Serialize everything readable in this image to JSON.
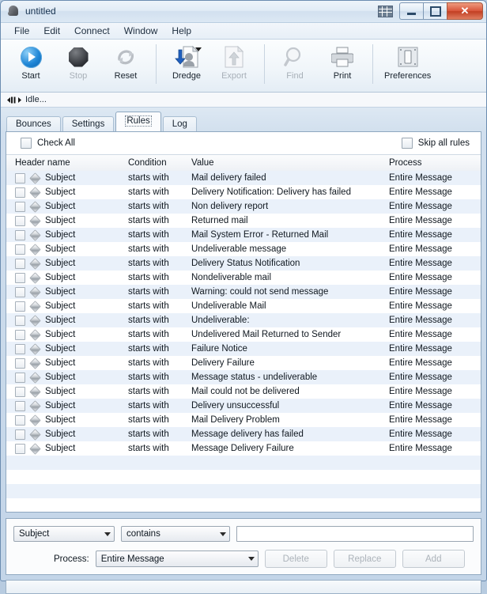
{
  "window": {
    "title": "untitled",
    "app_icon": "boot-icon",
    "controls": {
      "grid": "grid-icon",
      "minimize": "minimize-icon",
      "maximize": "maximize-icon",
      "close": "✕"
    }
  },
  "menu": [
    "File",
    "Edit",
    "Connect",
    "Window",
    "Help"
  ],
  "toolbar": [
    {
      "label": "Start",
      "icon": "play-icon",
      "disabled": false,
      "dropdown": false
    },
    {
      "label": "Stop",
      "icon": "stop-octagon-icon",
      "disabled": true,
      "dropdown": false
    },
    {
      "label": "Reset",
      "icon": "refresh-icon",
      "disabled": false,
      "dropdown": false
    },
    {
      "label": "Dredge",
      "icon": "dredge-download-icon",
      "disabled": false,
      "dropdown": true
    },
    {
      "label": "Export",
      "icon": "export-upload-icon",
      "disabled": true,
      "dropdown": false
    },
    {
      "label": "Find",
      "icon": "magnifier-icon",
      "disabled": true,
      "dropdown": false
    },
    {
      "label": "Print",
      "icon": "printer-icon",
      "disabled": false,
      "dropdown": false
    },
    {
      "label": "Preferences",
      "icon": "preferences-icon",
      "disabled": false,
      "dropdown": false
    }
  ],
  "status": {
    "icon": "connection-icon",
    "text": "Idle..."
  },
  "tabs": [
    {
      "label": "Bounces",
      "active": false
    },
    {
      "label": "Settings",
      "active": false
    },
    {
      "label": "Rules",
      "active": true
    },
    {
      "label": "Log",
      "active": false
    }
  ],
  "controls_bar": {
    "check_all_label": "Check All",
    "check_all_checked": false,
    "skip_all_label": "Skip all rules",
    "skip_all_checked": false
  },
  "table": {
    "columns": [
      "Header name",
      "Condition",
      "Value",
      "Process"
    ],
    "rows": [
      {
        "header": "Subject",
        "condition": "starts with",
        "value": "Mail delivery failed",
        "process": "Entire Message",
        "checked": false
      },
      {
        "header": "Subject",
        "condition": "starts with",
        "value": "Delivery Notification: Delivery has failed",
        "process": "Entire Message",
        "checked": false
      },
      {
        "header": "Subject",
        "condition": "starts with",
        "value": "Non delivery report",
        "process": "Entire Message",
        "checked": false
      },
      {
        "header": "Subject",
        "condition": "starts with",
        "value": "Returned mail",
        "process": "Entire Message",
        "checked": false
      },
      {
        "header": "Subject",
        "condition": "starts with",
        "value": "Mail System Error - Returned Mail",
        "process": "Entire Message",
        "checked": false
      },
      {
        "header": "Subject",
        "condition": "starts with",
        "value": "Undeliverable message",
        "process": "Entire Message",
        "checked": false
      },
      {
        "header": "Subject",
        "condition": "starts with",
        "value": "Delivery Status Notification",
        "process": "Entire Message",
        "checked": false
      },
      {
        "header": "Subject",
        "condition": "starts with",
        "value": "Nondeliverable mail",
        "process": "Entire Message",
        "checked": false
      },
      {
        "header": "Subject",
        "condition": "starts with",
        "value": "Warning: could not send message",
        "process": "Entire Message",
        "checked": false
      },
      {
        "header": "Subject",
        "condition": "starts with",
        "value": "Undeliverable Mail",
        "process": "Entire Message",
        "checked": false
      },
      {
        "header": "Subject",
        "condition": "starts with",
        "value": "Undeliverable:",
        "process": "Entire Message",
        "checked": false
      },
      {
        "header": "Subject",
        "condition": "starts with",
        "value": "Undelivered Mail Returned to Sender",
        "process": "Entire Message",
        "checked": false
      },
      {
        "header": "Subject",
        "condition": "starts with",
        "value": "Failure Notice",
        "process": "Entire Message",
        "checked": false
      },
      {
        "header": "Subject",
        "condition": "starts with",
        "value": "Delivery Failure",
        "process": "Entire Message",
        "checked": false
      },
      {
        "header": "Subject",
        "condition": "starts with",
        "value": "Message status - undeliverable",
        "process": "Entire Message",
        "checked": false
      },
      {
        "header": "Subject",
        "condition": "starts with",
        "value": "Mail could not be delivered",
        "process": "Entire Message",
        "checked": false
      },
      {
        "header": "Subject",
        "condition": "starts with",
        "value": "Delivery unsuccessful",
        "process": "Entire Message",
        "checked": false
      },
      {
        "header": "Subject",
        "condition": "starts with",
        "value": "Mail Delivery Problem",
        "process": "Entire Message",
        "checked": false
      },
      {
        "header": "Subject",
        "condition": "starts with",
        "value": "Message delivery has failed",
        "process": "Entire Message",
        "checked": false
      },
      {
        "header": "Subject",
        "condition": "starts with",
        "value": "Message Delivery Failure",
        "process": "Entire Message",
        "checked": false
      }
    ],
    "empty_rows": 4
  },
  "editor": {
    "header_select": {
      "value": "Subject"
    },
    "condition_select": {
      "value": "contains"
    },
    "value_input": {
      "value": "",
      "placeholder": ""
    },
    "process_label": "Process:",
    "process_select": {
      "value": "Entire Message"
    },
    "buttons": [
      {
        "label": "Delete",
        "disabled": true
      },
      {
        "label": "Replace",
        "disabled": true
      },
      {
        "label": "Add",
        "disabled": true
      }
    ]
  }
}
